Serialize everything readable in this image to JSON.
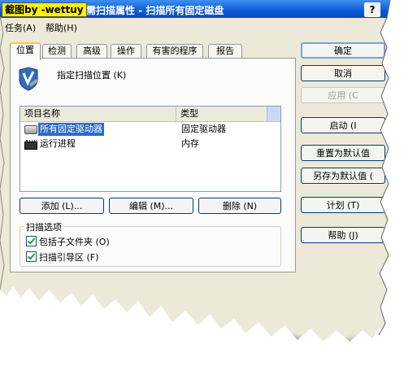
{
  "window": {
    "watermark": "截图by -wettuy",
    "title": "按需扫描属性 - 扫描所有固定磁盘",
    "help_glyph": "?"
  },
  "menu": [
    {
      "label": "任务(A)"
    },
    {
      "label": "帮助(H)"
    }
  ],
  "tabs": [
    {
      "label": "位置",
      "active": true
    },
    {
      "label": "检测"
    },
    {
      "label": "高级"
    },
    {
      "label": "操作"
    },
    {
      "label": "有害的程序"
    },
    {
      "label": "报告"
    }
  ],
  "location": {
    "heading": "指定扫描位置 (K)",
    "columns": [
      "项目名称",
      "类型"
    ],
    "rows": [
      {
        "name": "所有固定驱动器",
        "type": "固定驱动器",
        "selected": true,
        "icon": "drive-icon"
      },
      {
        "name": "运行进程",
        "type": "内存",
        "selected": false,
        "icon": "process-icon"
      }
    ],
    "buttons": {
      "add": "添加 (L)...",
      "edit": "编辑 (M)...",
      "delete": "删除 (N)"
    }
  },
  "scan_options": {
    "label": "扫描选项",
    "items": [
      {
        "label": "包括子文件夹 (O)",
        "checked": true
      },
      {
        "label": "扫描引导区 (F)",
        "checked": true
      }
    ]
  },
  "side_buttons": {
    "ok": "确定",
    "cancel": "取消",
    "apply": "应用 (C",
    "start": "启动 (I",
    "reset": "重置为默认值",
    "save_default": "另存为默认值 (",
    "schedule": "计划 (T)",
    "help": "帮助 (J)"
  },
  "colors": {
    "titlebar": "#0a5ad8",
    "selection": "#316ac5",
    "watermark_bg": "#fff200"
  }
}
